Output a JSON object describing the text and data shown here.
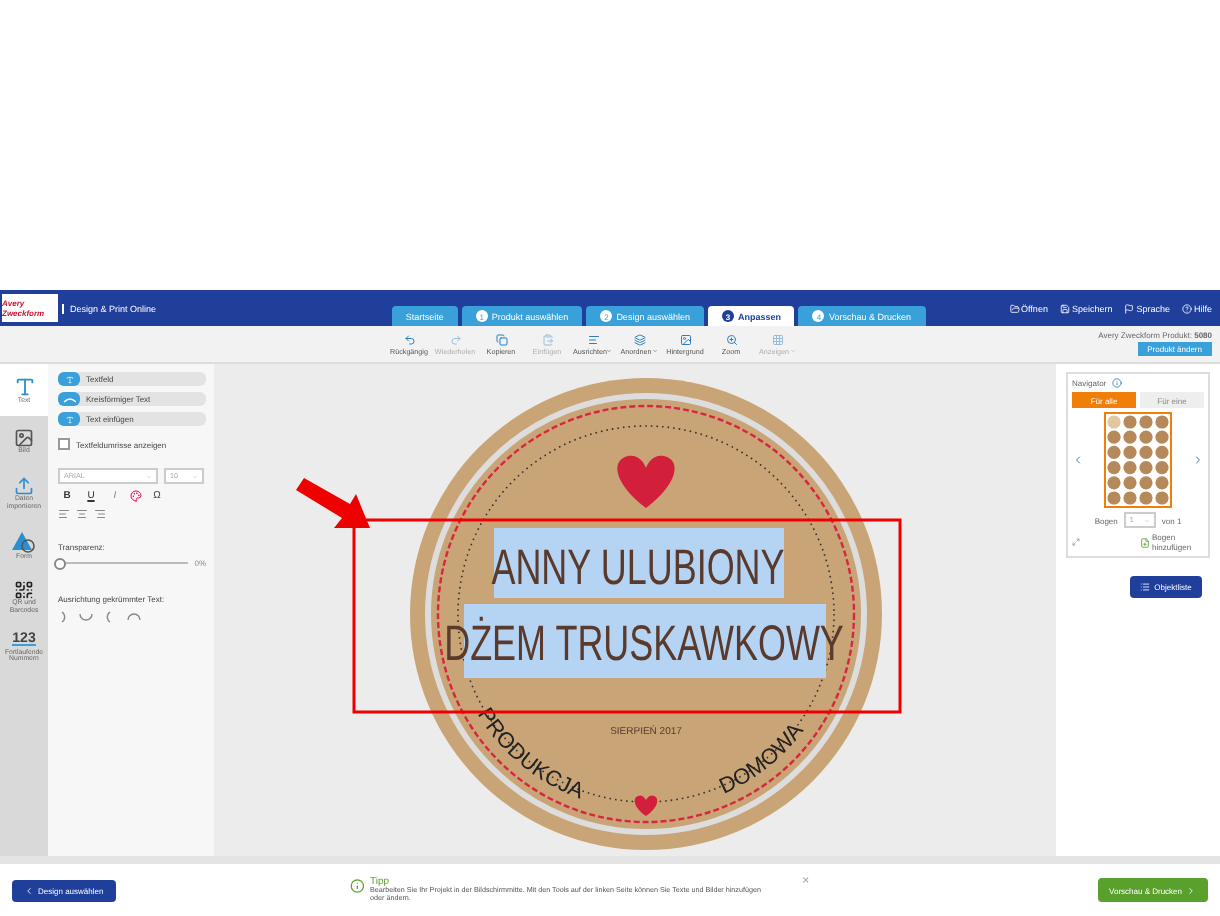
{
  "header": {
    "logo": "Avery Zweckform",
    "title": "Design & Print Online",
    "steps": [
      {
        "label": "Startseite",
        "selected": false
      },
      {
        "number": "1",
        "label": "Produkt auswählen",
        "selected": false
      },
      {
        "number": "2",
        "label": "Design auswählen",
        "selected": false
      },
      {
        "number": "3",
        "label": "Anpassen",
        "selected": true
      },
      {
        "number": "4",
        "label": "Vorschau & Drucken",
        "selected": false
      }
    ],
    "actions": [
      {
        "kind": "open",
        "label": "Öffnen"
      },
      {
        "kind": "save",
        "label": "Speichern"
      },
      {
        "kind": "language",
        "label": "Sprache"
      },
      {
        "kind": "help",
        "label": "Hilfe"
      }
    ]
  },
  "toolbar": {
    "tools": [
      {
        "kind": "undo",
        "label": "Rückgängig",
        "disabled": false,
        "dropdown": false
      },
      {
        "kind": "redo",
        "label": "Wiederholen",
        "disabled": true,
        "dropdown": false
      },
      {
        "kind": "copy",
        "label": "Kopieren",
        "disabled": false,
        "dropdown": false
      },
      {
        "kind": "paste",
        "label": "Einfügen",
        "disabled": true,
        "dropdown": false
      },
      {
        "kind": "align",
        "label": "Ausrichten",
        "disabled": false,
        "dropdown": true
      },
      {
        "kind": "arrange",
        "label": "Anordnen",
        "disabled": false,
        "dropdown": true
      },
      {
        "kind": "background",
        "label": "Hintergrund",
        "disabled": false,
        "dropdown": false
      },
      {
        "kind": "zoom",
        "label": "Zoom",
        "disabled": false,
        "dropdown": false
      },
      {
        "kind": "grid",
        "label": "Anzeigen",
        "disabled": true,
        "dropdown": true
      }
    ],
    "product_label": "Avery Zweckform Produkt:",
    "product_number": "5080",
    "change_button": "Produkt ändern"
  },
  "rail": [
    {
      "kind": "text",
      "label": "Text",
      "selected": true
    },
    {
      "kind": "image",
      "label": "Bild",
      "selected": false
    },
    {
      "kind": "import",
      "label": "Daten importieren",
      "selected": false
    },
    {
      "kind": "shape",
      "label": "Form",
      "selected": false
    },
    {
      "kind": "qr",
      "label": "QR und Barcodes",
      "selected": false
    },
    {
      "kind": "numbers",
      "label": "Fortlaufende Nummern",
      "glyph": "123",
      "selected": false
    }
  ],
  "text_panel": {
    "buttons": [
      {
        "kind": "textbox",
        "label": "Textfeld"
      },
      {
        "kind": "curved",
        "label": "Kreisförmiger Text"
      },
      {
        "kind": "insert",
        "label": "Text einfügen"
      }
    ],
    "outline_checkbox": {
      "label": "Textfeldumrisse anzeigen",
      "checked": false
    },
    "font": "ARIAL",
    "size": "10",
    "format": [
      "B",
      "U",
      "I"
    ],
    "special_char": "Ω",
    "transparency": {
      "label": "Transparenz:",
      "level": 0,
      "reading": "0%"
    },
    "curve_label": "Ausrichtung gekrümmter Text:"
  },
  "canvas": {
    "label_lines": [
      "ANNY ULUBIONY",
      "DŻEM TRUSKAWKOWY"
    ],
    "date": "SIERPIEŃ 2017",
    "curved_left": "PRODUKCJA",
    "curved_right": "DOMOWA"
  },
  "navigator": {
    "title": "Navigator",
    "tabs": [
      {
        "label": "Für alle",
        "selected": true
      },
      {
        "label": "Für eine",
        "selected": false
      }
    ],
    "sheet_label": "Bogen",
    "sheet": "1",
    "sheet_of": "von 1",
    "add_sheet": "Bogen hinzufügen",
    "object_list": "Objektliste"
  },
  "footer": {
    "back": "Design auswählen",
    "tip_title": "Tipp",
    "tip_text": "Bearbeiten Sie Ihr Projekt in der Bildschirmmitte. Mit den Tools auf der linken Seite können Sie Texte und Bilder hinzufügen oder ändern.",
    "close": "×",
    "next": "Vorschau & Drucken"
  }
}
